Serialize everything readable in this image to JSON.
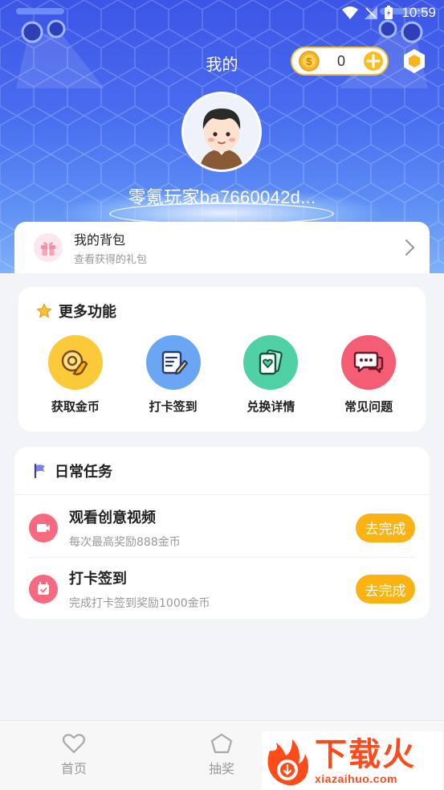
{
  "status_bar": {
    "time": "10:59"
  },
  "header": {
    "title": "我的",
    "coins": "0",
    "username": "零氪玩家ba7660042d..."
  },
  "backpack": {
    "title": "我的背包",
    "subtitle": "查看获得的礼包"
  },
  "more_functions": {
    "title": "更多功能",
    "items": [
      {
        "label": "获取金币",
        "icon": "coin-hand-icon",
        "color": "#fbc93a"
      },
      {
        "label": "打卡签到",
        "icon": "checkin-card-icon",
        "color": "#6aa6f4"
      },
      {
        "label": "兑换详情",
        "icon": "exchange-cards-icon",
        "color": "#4fd1a5"
      },
      {
        "label": "常见问题",
        "icon": "chat-bubbles-icon",
        "color": "#f45d74"
      }
    ]
  },
  "daily_tasks": {
    "title": "日常任务",
    "tasks": [
      {
        "title": "观看创意视频",
        "subtitle": "每次最高奖励888金币",
        "button": "去完成",
        "icon": "video-icon"
      },
      {
        "title": "打卡签到",
        "subtitle": "完成打卡签到奖励1000金币",
        "button": "去完成",
        "icon": "calendar-icon"
      }
    ]
  },
  "bottom_nav": {
    "items": [
      {
        "label": "首页",
        "icon": "heart-icon"
      },
      {
        "label": "抽奖",
        "icon": "pentagon-icon"
      }
    ]
  },
  "watermark": {
    "big": "下载火",
    "small": "xiazaihuo.com"
  },
  "colors": {
    "accent": "#fbb313",
    "header_top": "#3d55e6",
    "task_icon": "#f7697f"
  }
}
